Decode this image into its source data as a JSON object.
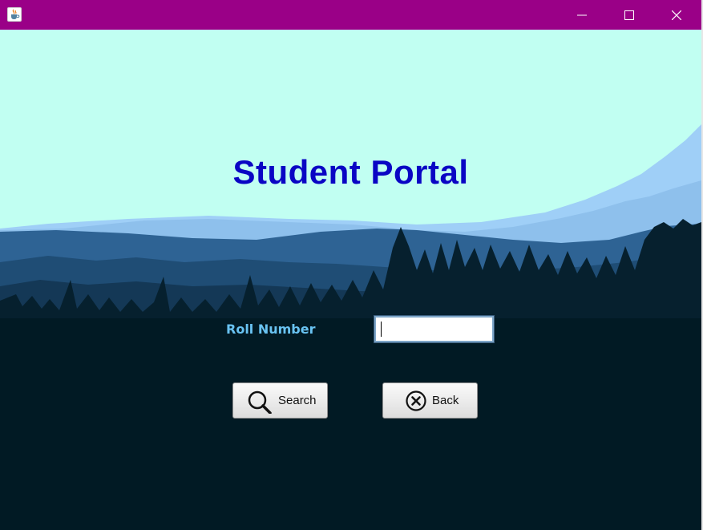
{
  "window": {
    "title": "",
    "titlebar_color": "#9a0087",
    "controls": {
      "minimize": "minimize-icon",
      "maximize": "maximize-icon",
      "close": "close-icon"
    }
  },
  "app_icon": "java-cup-icon",
  "page": {
    "title": "Student Portal",
    "title_color": "#0a05c4",
    "background": "mountain-forest-landscape"
  },
  "form": {
    "roll_label": "Roll Number",
    "roll_value": "",
    "label_color": "#69c3f2"
  },
  "buttons": {
    "search": {
      "label": "Search",
      "icon": "search-icon"
    },
    "back": {
      "label": "Back",
      "icon": "close-circle-icon"
    }
  }
}
